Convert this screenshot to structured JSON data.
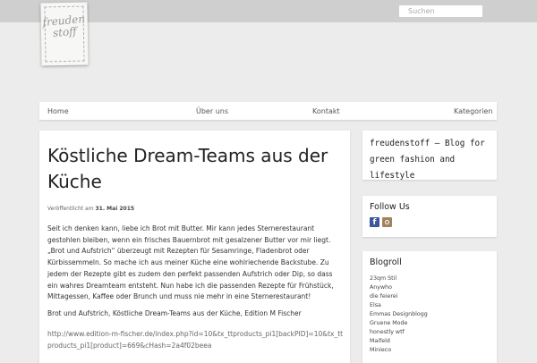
{
  "search": {
    "placeholder": "Suchen"
  },
  "logo": {
    "line1": "freuden",
    "line2": "stoff"
  },
  "nav": {
    "items": [
      "Home",
      "Über uns",
      "Kontakt",
      "Kategorien"
    ]
  },
  "post": {
    "title": "Köstliche Dream-Teams aus der Küche",
    "posted_label": "Veröffentlicht am",
    "date": "31. Mai 2015",
    "paragraph1": "Seit ich denken kann, liebe ich Brot mit Butter. Mir kann jedes Sternerestaurant gestohlen bleiben, wenn ein frisches Bauernbrot mit gesalzener Butter vor mir liegt. „Brot und Aufstrich“ überzeugt mit Rezepten für Sesamringe, Fladenbrot oder Kürbissemmeln. So mache ich aus meiner Küche eine wohlriechende Backstube. Zu jedem der Rezepte gibt es zudem den perfekt passenden Aufstrich oder Dip, so dass ein wahres Dreamteam entsteht. Nun habe ich die passenden Rezepte für Frühstück, Mittagessen, Kaffee oder Brunch und muss nie mehr in eine Sternerestaurant!",
    "paragraph2": "Brot und Aufstrich, Köstliche Dream-Teams aus der Küche, Edition M Fischer",
    "link": "http://www.edition-m-fischer.de/index.php?id=10&tx_ttproducts_pi1[backPID]=10&tx_ttproducts_pi1[product]=669&cHash=2a4f02beea"
  },
  "sidebar": {
    "tagline": "freudenstoff – Blog for green fashion and lifestyle",
    "follow_title": "Follow Us",
    "facebook_letter": "f",
    "blogroll_title": "Blogroll",
    "blogroll": [
      "23qm Stil",
      "Anywho",
      "die feierei",
      "Elsa",
      "Emmas Designblogg",
      "Gruene Mode",
      "honestly wtf",
      "Maifeld",
      "Minieco"
    ]
  }
}
